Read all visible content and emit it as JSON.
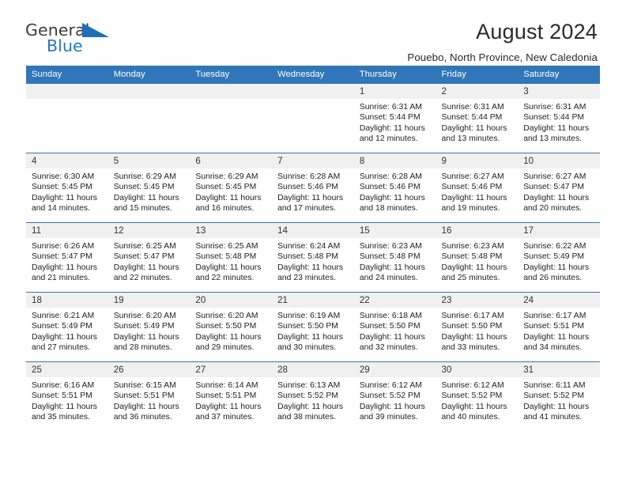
{
  "brand": {
    "name_part1": "General",
    "name_part2": "Blue",
    "triangle_icon": "triangle-icon",
    "accent_color": "#2277c8",
    "header_color": "#3076b8"
  },
  "header": {
    "title": "August 2024",
    "location": "Pouebo, North Province, New Caledonia"
  },
  "calendar": {
    "weekday_headers": [
      "Sunday",
      "Monday",
      "Tuesday",
      "Wednesday",
      "Thursday",
      "Friday",
      "Saturday"
    ],
    "labels": {
      "sunrise": "Sunrise:",
      "sunset": "Sunset:",
      "daylight": "Daylight:"
    },
    "weeks": [
      [
        {
          "day": "",
          "empty": true
        },
        {
          "day": "",
          "empty": true
        },
        {
          "day": "",
          "empty": true
        },
        {
          "day": "",
          "empty": true
        },
        {
          "day": "1",
          "sunrise": "Sunrise: 6:31 AM",
          "sunset": "Sunset: 5:44 PM",
          "daylight_line1": "Daylight: 11 hours",
          "daylight_line2": "and 12 minutes."
        },
        {
          "day": "2",
          "sunrise": "Sunrise: 6:31 AM",
          "sunset": "Sunset: 5:44 PM",
          "daylight_line1": "Daylight: 11 hours",
          "daylight_line2": "and 13 minutes."
        },
        {
          "day": "3",
          "sunrise": "Sunrise: 6:31 AM",
          "sunset": "Sunset: 5:44 PM",
          "daylight_line1": "Daylight: 11 hours",
          "daylight_line2": "and 13 minutes."
        }
      ],
      [
        {
          "day": "4",
          "sunrise": "Sunrise: 6:30 AM",
          "sunset": "Sunset: 5:45 PM",
          "daylight_line1": "Daylight: 11 hours",
          "daylight_line2": "and 14 minutes."
        },
        {
          "day": "5",
          "sunrise": "Sunrise: 6:29 AM",
          "sunset": "Sunset: 5:45 PM",
          "daylight_line1": "Daylight: 11 hours",
          "daylight_line2": "and 15 minutes."
        },
        {
          "day": "6",
          "sunrise": "Sunrise: 6:29 AM",
          "sunset": "Sunset: 5:45 PM",
          "daylight_line1": "Daylight: 11 hours",
          "daylight_line2": "and 16 minutes."
        },
        {
          "day": "7",
          "sunrise": "Sunrise: 6:28 AM",
          "sunset": "Sunset: 5:46 PM",
          "daylight_line1": "Daylight: 11 hours",
          "daylight_line2": "and 17 minutes."
        },
        {
          "day": "8",
          "sunrise": "Sunrise: 6:28 AM",
          "sunset": "Sunset: 5:46 PM",
          "daylight_line1": "Daylight: 11 hours",
          "daylight_line2": "and 18 minutes."
        },
        {
          "day": "9",
          "sunrise": "Sunrise: 6:27 AM",
          "sunset": "Sunset: 5:46 PM",
          "daylight_line1": "Daylight: 11 hours",
          "daylight_line2": "and 19 minutes."
        },
        {
          "day": "10",
          "sunrise": "Sunrise: 6:27 AM",
          "sunset": "Sunset: 5:47 PM",
          "daylight_line1": "Daylight: 11 hours",
          "daylight_line2": "and 20 minutes."
        }
      ],
      [
        {
          "day": "11",
          "sunrise": "Sunrise: 6:26 AM",
          "sunset": "Sunset: 5:47 PM",
          "daylight_line1": "Daylight: 11 hours",
          "daylight_line2": "and 21 minutes."
        },
        {
          "day": "12",
          "sunrise": "Sunrise: 6:25 AM",
          "sunset": "Sunset: 5:47 PM",
          "daylight_line1": "Daylight: 11 hours",
          "daylight_line2": "and 22 minutes."
        },
        {
          "day": "13",
          "sunrise": "Sunrise: 6:25 AM",
          "sunset": "Sunset: 5:48 PM",
          "daylight_line1": "Daylight: 11 hours",
          "daylight_line2": "and 22 minutes."
        },
        {
          "day": "14",
          "sunrise": "Sunrise: 6:24 AM",
          "sunset": "Sunset: 5:48 PM",
          "daylight_line1": "Daylight: 11 hours",
          "daylight_line2": "and 23 minutes."
        },
        {
          "day": "15",
          "sunrise": "Sunrise: 6:23 AM",
          "sunset": "Sunset: 5:48 PM",
          "daylight_line1": "Daylight: 11 hours",
          "daylight_line2": "and 24 minutes."
        },
        {
          "day": "16",
          "sunrise": "Sunrise: 6:23 AM",
          "sunset": "Sunset: 5:48 PM",
          "daylight_line1": "Daylight: 11 hours",
          "daylight_line2": "and 25 minutes."
        },
        {
          "day": "17",
          "sunrise": "Sunrise: 6:22 AM",
          "sunset": "Sunset: 5:49 PM",
          "daylight_line1": "Daylight: 11 hours",
          "daylight_line2": "and 26 minutes."
        }
      ],
      [
        {
          "day": "18",
          "sunrise": "Sunrise: 6:21 AM",
          "sunset": "Sunset: 5:49 PM",
          "daylight_line1": "Daylight: 11 hours",
          "daylight_line2": "and 27 minutes."
        },
        {
          "day": "19",
          "sunrise": "Sunrise: 6:20 AM",
          "sunset": "Sunset: 5:49 PM",
          "daylight_line1": "Daylight: 11 hours",
          "daylight_line2": "and 28 minutes."
        },
        {
          "day": "20",
          "sunrise": "Sunrise: 6:20 AM",
          "sunset": "Sunset: 5:50 PM",
          "daylight_line1": "Daylight: 11 hours",
          "daylight_line2": "and 29 minutes."
        },
        {
          "day": "21",
          "sunrise": "Sunrise: 6:19 AM",
          "sunset": "Sunset: 5:50 PM",
          "daylight_line1": "Daylight: 11 hours",
          "daylight_line2": "and 30 minutes."
        },
        {
          "day": "22",
          "sunrise": "Sunrise: 6:18 AM",
          "sunset": "Sunset: 5:50 PM",
          "daylight_line1": "Daylight: 11 hours",
          "daylight_line2": "and 32 minutes."
        },
        {
          "day": "23",
          "sunrise": "Sunrise: 6:17 AM",
          "sunset": "Sunset: 5:50 PM",
          "daylight_line1": "Daylight: 11 hours",
          "daylight_line2": "and 33 minutes."
        },
        {
          "day": "24",
          "sunrise": "Sunrise: 6:17 AM",
          "sunset": "Sunset: 5:51 PM",
          "daylight_line1": "Daylight: 11 hours",
          "daylight_line2": "and 34 minutes."
        }
      ],
      [
        {
          "day": "25",
          "sunrise": "Sunrise: 6:16 AM",
          "sunset": "Sunset: 5:51 PM",
          "daylight_line1": "Daylight: 11 hours",
          "daylight_line2": "and 35 minutes."
        },
        {
          "day": "26",
          "sunrise": "Sunrise: 6:15 AM",
          "sunset": "Sunset: 5:51 PM",
          "daylight_line1": "Daylight: 11 hours",
          "daylight_line2": "and 36 minutes."
        },
        {
          "day": "27",
          "sunrise": "Sunrise: 6:14 AM",
          "sunset": "Sunset: 5:51 PM",
          "daylight_line1": "Daylight: 11 hours",
          "daylight_line2": "and 37 minutes."
        },
        {
          "day": "28",
          "sunrise": "Sunrise: 6:13 AM",
          "sunset": "Sunset: 5:52 PM",
          "daylight_line1": "Daylight: 11 hours",
          "daylight_line2": "and 38 minutes."
        },
        {
          "day": "29",
          "sunrise": "Sunrise: 6:12 AM",
          "sunset": "Sunset: 5:52 PM",
          "daylight_line1": "Daylight: 11 hours",
          "daylight_line2": "and 39 minutes."
        },
        {
          "day": "30",
          "sunrise": "Sunrise: 6:12 AM",
          "sunset": "Sunset: 5:52 PM",
          "daylight_line1": "Daylight: 11 hours",
          "daylight_line2": "and 40 minutes."
        },
        {
          "day": "31",
          "sunrise": "Sunrise: 6:11 AM",
          "sunset": "Sunset: 5:52 PM",
          "daylight_line1": "Daylight: 11 hours",
          "daylight_line2": "and 41 minutes."
        }
      ]
    ]
  }
}
